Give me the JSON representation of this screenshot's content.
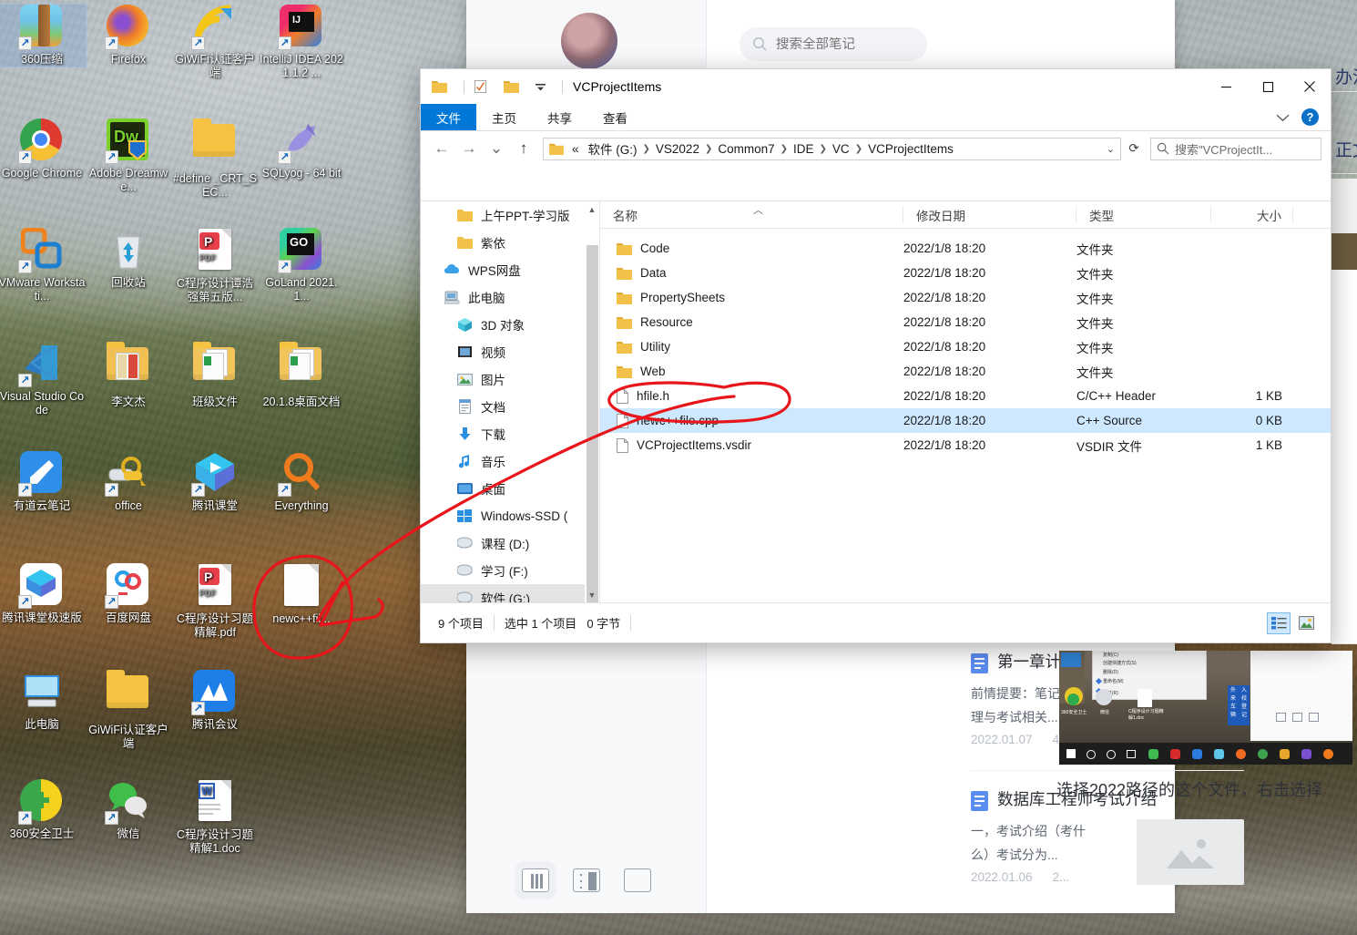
{
  "desktop": {
    "icons": [
      {
        "label": "360压缩",
        "kind": "app-360zip",
        "selected": true
      },
      {
        "label": "Firefox",
        "kind": "app-firefox"
      },
      {
        "label": "GiWiFi认证客户端",
        "kind": "app-giwifi"
      },
      {
        "label": "IntelliJ IDEA 2021.1.2 ...",
        "kind": "app-idea"
      },
      {
        "label": "Google Chrome",
        "kind": "app-chrome"
      },
      {
        "label": "Adobe Dreamwe...",
        "kind": "app-dreamweaver"
      },
      {
        "label": "#define _CRT_SEC...",
        "kind": "folder"
      },
      {
        "label": "SQLyog - 64 bit",
        "kind": "app-sqlyog"
      },
      {
        "label": "VMware Workstati...",
        "kind": "app-vmware"
      },
      {
        "label": "回收站",
        "kind": "recycle-bin"
      },
      {
        "label": "C程序设计谭浩强第五版...",
        "kind": "pdf"
      },
      {
        "label": "GoLand 2021.1...",
        "kind": "app-goland"
      },
      {
        "label": "Visual Studio Code",
        "kind": "app-vscode"
      },
      {
        "label": "李文杰",
        "kind": "folder-book"
      },
      {
        "label": "班级文件",
        "kind": "folder-files"
      },
      {
        "label": "20.1.8桌面文档",
        "kind": "folder-files"
      },
      {
        "label": "有道云笔记",
        "kind": "app-youdao"
      },
      {
        "label": "office",
        "kind": "app-office"
      },
      {
        "label": "腾讯课堂",
        "kind": "app-tencent-class"
      },
      {
        "label": "Everything",
        "kind": "app-everything"
      },
      {
        "label": "腾讯课堂极速版",
        "kind": "app-tencent-fast"
      },
      {
        "label": "百度网盘",
        "kind": "app-baidu-pan"
      },
      {
        "label": "C程序设计习题精解.pdf",
        "kind": "pdf"
      },
      {
        "label": "newc++fil...",
        "kind": "blank-file"
      },
      {
        "label": "此电脑",
        "kind": "this-pc"
      },
      {
        "label": "GiWiFi认证客户端",
        "kind": "folder"
      },
      {
        "label": "腾讯会议",
        "kind": "app-tencent-meeting"
      },
      {
        "label": "360安全卫士",
        "kind": "app-360safe"
      },
      {
        "label": "微信",
        "kind": "app-wechat"
      },
      {
        "label": "C程序设计习题精解1.doc",
        "kind": "doc"
      }
    ]
  },
  "notes_app": {
    "search": {
      "placeholder": "搜索全部笔记",
      "value": ""
    },
    "view_toggle_icon": "list-view-icon",
    "notes": [
      {
        "title": "第一章计算机系统知识",
        "snippet": "前情提要：笔记只整理与考试相关...",
        "date": "2022.01.07",
        "extra": "4...",
        "thumb": "handwritten-notebook-photo"
      },
      {
        "title": "数据库工程师考试介绍",
        "snippet": "一，考试介绍（考什么）考试分为...",
        "date": "2022.01.06",
        "extra": "2...",
        "thumb": "image-placeholder"
      }
    ],
    "layout_buttons": [
      "three-column-view",
      "two-column-view",
      "single-column-view"
    ],
    "editor_caption": "选择2022路径的这个文件，右击选择",
    "right_edge_text_1": "办法",
    "right_edge_text_2": "正文"
  },
  "explorer": {
    "title": "VCProjectItems",
    "quick_access": [
      "folder-icon",
      "properties-icon",
      "new-folder-icon",
      "customize-chevron-icon"
    ],
    "window_buttons": {
      "minimize": "－",
      "maximize": "☐",
      "close": "✕"
    },
    "ribbon_tabs": [
      {
        "label": "文件",
        "active": true
      },
      {
        "label": "主页",
        "active": false
      },
      {
        "label": "共享",
        "active": false
      },
      {
        "label": "查看",
        "active": false
      }
    ],
    "ribbon_right": {
      "collapse": "chevron-up-icon",
      "help": "?"
    },
    "nav": {
      "back": "←",
      "forward": "→",
      "recent": "⌄",
      "up": "↑",
      "refresh": "⟳"
    },
    "breadcrumb": {
      "prefix": "«",
      "items": [
        "软件 (G:)",
        "VS2022",
        "Common7",
        "IDE",
        "VC",
        "VCProjectItems"
      ]
    },
    "search_box": {
      "placeholder": "搜索\"VCProjectIt...",
      "value": ""
    },
    "nav_pane": [
      {
        "label": "上午PPT-学习版",
        "icon": "folder-icon",
        "indent": "sub"
      },
      {
        "label": "紫依",
        "icon": "folder-icon",
        "indent": "sub"
      },
      {
        "label": "WPS网盘",
        "icon": "cloud-icon",
        "indent": "root"
      },
      {
        "label": "此电脑",
        "icon": "pc-icon",
        "indent": "root"
      },
      {
        "label": "3D 对象",
        "icon": "3d-object-icon",
        "indent": "sub"
      },
      {
        "label": "视频",
        "icon": "video-icon",
        "indent": "sub"
      },
      {
        "label": "图片",
        "icon": "pictures-icon",
        "indent": "sub"
      },
      {
        "label": "文档",
        "icon": "documents-icon",
        "indent": "sub"
      },
      {
        "label": "下载",
        "icon": "downloads-icon",
        "indent": "sub"
      },
      {
        "label": "音乐",
        "icon": "music-icon",
        "indent": "sub"
      },
      {
        "label": "桌面",
        "icon": "desktop-icon",
        "indent": "sub"
      },
      {
        "label": "Windows-SSD (",
        "icon": "windows-drive-icon",
        "indent": "sub"
      },
      {
        "label": "课程 (D:)",
        "icon": "drive-icon",
        "indent": "sub"
      },
      {
        "label": "学习 (F:)",
        "icon": "drive-icon",
        "indent": "sub"
      },
      {
        "label": "软件 (G:)",
        "icon": "drive-icon",
        "indent": "sub",
        "selected": true
      }
    ],
    "columns": [
      {
        "key": "name",
        "label": "名称",
        "sorted": "asc"
      },
      {
        "key": "date",
        "label": "修改日期"
      },
      {
        "key": "type",
        "label": "类型"
      },
      {
        "key": "size",
        "label": "大小"
      }
    ],
    "files": [
      {
        "name": "Code",
        "date": "2022/1/8 18:20",
        "type": "文件夹",
        "size": "",
        "icon": "folder-icon"
      },
      {
        "name": "Data",
        "date": "2022/1/8 18:20",
        "type": "文件夹",
        "size": "",
        "icon": "folder-icon"
      },
      {
        "name": "PropertySheets",
        "date": "2022/1/8 18:20",
        "type": "文件夹",
        "size": "",
        "icon": "folder-icon"
      },
      {
        "name": "Resource",
        "date": "2022/1/8 18:20",
        "type": "文件夹",
        "size": "",
        "icon": "folder-icon"
      },
      {
        "name": "Utility",
        "date": "2022/1/8 18:20",
        "type": "文件夹",
        "size": "",
        "icon": "folder-icon"
      },
      {
        "name": "Web",
        "date": "2022/1/8 18:20",
        "type": "文件夹",
        "size": "",
        "icon": "folder-icon"
      },
      {
        "name": "hfile.h",
        "date": "2022/1/8 18:20",
        "type": "C/C++ Header",
        "size": "1 KB",
        "icon": "file-icon"
      },
      {
        "name": "newc++file.cpp",
        "date": "2022/1/8 18:20",
        "type": "C++ Source",
        "size": "0 KB",
        "icon": "file-icon",
        "selected": true
      },
      {
        "name": "VCProjectItems.vsdir",
        "date": "2022/1/8 18:20",
        "type": "VSDIR 文件",
        "size": "1 KB",
        "icon": "file-icon"
      }
    ],
    "status": {
      "count": "9 个项目",
      "selection": "选中 1 个项目",
      "bytes": "0 字节"
    },
    "status_views": [
      "details-view-icon",
      "large-icons-view-icon"
    ]
  },
  "annotation": {
    "color": "#e8151b",
    "marks": [
      "ellipse-around-desktop-file",
      "arrow-to-explorer-row",
      "ellipse-around-selected-row"
    ]
  }
}
